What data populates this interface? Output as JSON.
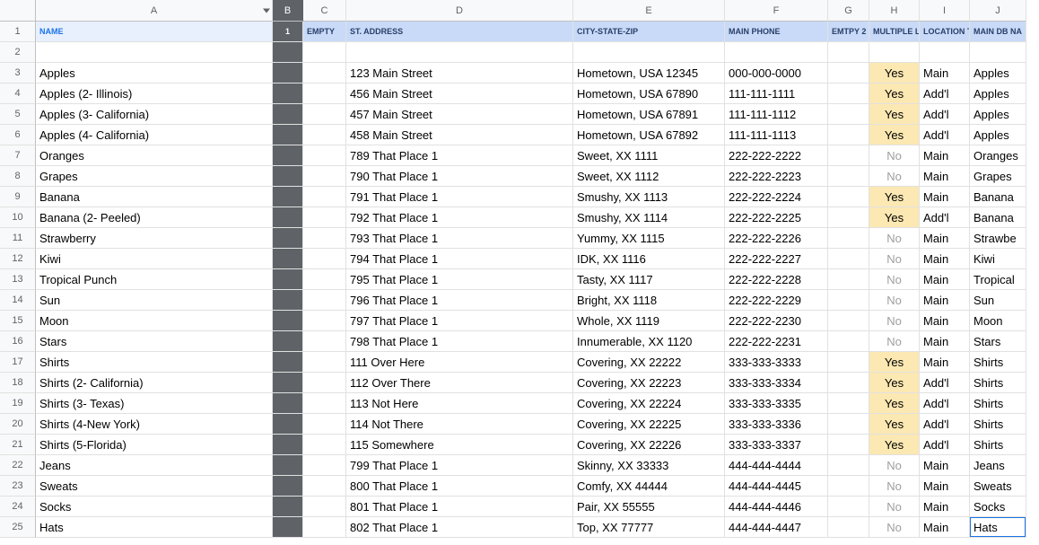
{
  "columns": [
    "A",
    "B",
    "C",
    "D",
    "E",
    "F",
    "G",
    "H",
    "I",
    "J"
  ],
  "selectedCol": "B",
  "headers": {
    "A": "NAME",
    "B": "1",
    "C": "EMPTY",
    "D": "ST. ADDRESS",
    "E": "CITY-STATE-ZIP",
    "F": "MAIN PHONE",
    "G": "EMTPY 2",
    "H": "MULTIPLE L",
    "I": "LOCATION T",
    "J": "MAIN DB NA"
  },
  "labels": {
    "yes": "Yes",
    "no": "No"
  },
  "rows": [
    {
      "n": 3,
      "A": "Apples",
      "D": "123 Main Street",
      "E": "Hometown, USA 12345",
      "F": "000-000-0000",
      "H": "Yes",
      "I": "Main",
      "J": "Apples"
    },
    {
      "n": 4,
      "A": "Apples (2- Illinois)",
      "D": "456 Main Street",
      "E": "Hometown, USA 67890",
      "F": "111-111-1111",
      "H": "Yes",
      "I": "Add'l",
      "J": "Apples"
    },
    {
      "n": 5,
      "A": "Apples (3- California)",
      "D": "457 Main Street",
      "E": "Hometown, USA 67891",
      "F": "111-111-1112",
      "H": "Yes",
      "I": "Add'l",
      "J": "Apples"
    },
    {
      "n": 6,
      "A": "Apples (4- California)",
      "D": "458 Main Street",
      "E": "Hometown, USA 67892",
      "F": "111-111-1113",
      "H": "Yes",
      "I": "Add'l",
      "J": "Apples"
    },
    {
      "n": 7,
      "A": "Oranges",
      "D": "789 That Place 1",
      "E": "Sweet, XX 1111",
      "F": "222-222-2222",
      "H": "No",
      "I": "Main",
      "J": "Oranges"
    },
    {
      "n": 8,
      "A": "Grapes",
      "D": "790 That Place 1",
      "E": "Sweet, XX 1112",
      "F": "222-222-2223",
      "H": "No",
      "I": "Main",
      "J": "Grapes"
    },
    {
      "n": 9,
      "A": "Banana",
      "D": "791 That Place 1",
      "E": "Smushy, XX 1113",
      "F": "222-222-2224",
      "H": "Yes",
      "I": "Main",
      "J": "Banana"
    },
    {
      "n": 10,
      "A": "Banana (2- Peeled)",
      "D": "792 That Place 1",
      "E": "Smushy, XX 1114",
      "F": "222-222-2225",
      "H": "Yes",
      "I": "Add'l",
      "J": "Banana"
    },
    {
      "n": 11,
      "A": "Strawberry",
      "D": "793 That Place 1",
      "E": "Yummy, XX 1115",
      "F": "222-222-2226",
      "H": "No",
      "I": "Main",
      "J": "Strawbe"
    },
    {
      "n": 12,
      "A": "Kiwi",
      "D": "794 That Place 1",
      "E": "IDK, XX 1116",
      "F": "222-222-2227",
      "H": "No",
      "I": "Main",
      "J": "Kiwi"
    },
    {
      "n": 13,
      "A": "Tropical Punch",
      "D": "795 That Place 1",
      "E": "Tasty, XX 1117",
      "F": "222-222-2228",
      "H": "No",
      "I": "Main",
      "J": "Tropical"
    },
    {
      "n": 14,
      "A": "Sun",
      "D": "796 That Place 1",
      "E": "Bright, XX 1118",
      "F": "222-222-2229",
      "H": "No",
      "I": "Main",
      "J": "Sun"
    },
    {
      "n": 15,
      "A": "Moon",
      "D": "797 That Place 1",
      "E": "Whole, XX 1119",
      "F": "222-222-2230",
      "H": "No",
      "I": "Main",
      "J": "Moon"
    },
    {
      "n": 16,
      "A": "Stars",
      "D": "798 That Place 1",
      "E": "Innumerable, XX 1120",
      "F": "222-222-2231",
      "H": "No",
      "I": "Main",
      "J": "Stars"
    },
    {
      "n": 17,
      "A": "Shirts",
      "D": "111 Over Here",
      "E": "Covering, XX 22222",
      "F": "333-333-3333",
      "H": "Yes",
      "I": "Main",
      "J": "Shirts"
    },
    {
      "n": 18,
      "A": "Shirts (2- California)",
      "D": "112 Over There",
      "E": "Covering, XX 22223",
      "F": "333-333-3334",
      "H": "Yes",
      "I": "Add'l",
      "J": "Shirts"
    },
    {
      "n": 19,
      "A": "Shirts (3- Texas)",
      "D": "113 Not Here",
      "E": "Covering, XX 22224",
      "F": "333-333-3335",
      "H": "Yes",
      "I": "Add'l",
      "J": "Shirts"
    },
    {
      "n": 20,
      "A": "Shirts (4-New York)",
      "D": "114 Not There",
      "E": "Covering, XX 22225",
      "F": "333-333-3336",
      "H": "Yes",
      "I": "Add'l",
      "J": "Shirts"
    },
    {
      "n": 21,
      "A": "Shirts (5-Florida)",
      "D": "115 Somewhere",
      "E": "Covering, XX 22226",
      "F": "333-333-3337",
      "H": "Yes",
      "I": "Add'l",
      "J": "Shirts"
    },
    {
      "n": 22,
      "A": "Jeans",
      "D": "799 That Place 1",
      "E": "Skinny, XX 33333",
      "F": "444-444-4444",
      "H": "No",
      "I": "Main",
      "J": "Jeans"
    },
    {
      "n": 23,
      "A": "Sweats",
      "D": "800 That Place 1",
      "E": "Comfy, XX 44444",
      "F": "444-444-4445",
      "H": "No",
      "I": "Main",
      "J": "Sweats"
    },
    {
      "n": 24,
      "A": "Socks",
      "D": "801 That Place 1",
      "E": "Pair, XX 55555",
      "F": "444-444-4446",
      "H": "No",
      "I": "Main",
      "J": "Socks"
    },
    {
      "n": 25,
      "A": "Hats",
      "D": "802 That Place 1",
      "E": "Top, XX 77777",
      "F": "444-444-4447",
      "H": "No",
      "I": "Main",
      "J": "Hats",
      "selJ": true
    }
  ]
}
